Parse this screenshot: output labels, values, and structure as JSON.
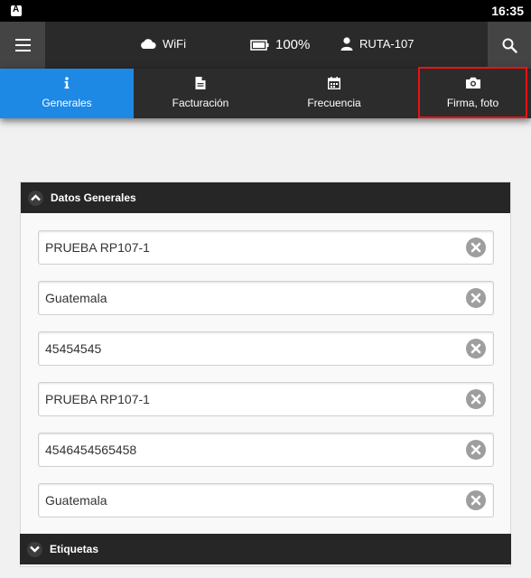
{
  "status_bar": {
    "time": "16:35",
    "app_letter": "A"
  },
  "top_bar": {
    "wifi_label": "WiFi",
    "battery_label": "100%",
    "user_label": "RUTA-107",
    "icons": {
      "menu": "hamburger-icon",
      "search": "search-icon",
      "wifi": "cloud-icon",
      "battery": "battery-icon",
      "user": "user-icon"
    }
  },
  "tabs": [
    {
      "label": "Generales",
      "icon": "info-icon",
      "active": true
    },
    {
      "label": "Facturación",
      "icon": "document-icon",
      "active": false
    },
    {
      "label": "Frecuencia",
      "icon": "calendar-icon",
      "active": false
    },
    {
      "label": "Firma, foto",
      "icon": "camera-icon",
      "active": false
    }
  ],
  "panel": {
    "title": "Datos Generales",
    "fields": [
      {
        "value": "PRUEBA RP107-1"
      },
      {
        "value": "Guatemala"
      },
      {
        "value": "45454545"
      },
      {
        "value": "PRUEBA RP107-1"
      },
      {
        "value": "4546454565458"
      },
      {
        "value": "Guatemala"
      }
    ],
    "footer_title": "Etiquetas"
  },
  "colors": {
    "accent": "#1e88e5",
    "highlight": "#ee1111",
    "bar": "#2a2a2a"
  }
}
